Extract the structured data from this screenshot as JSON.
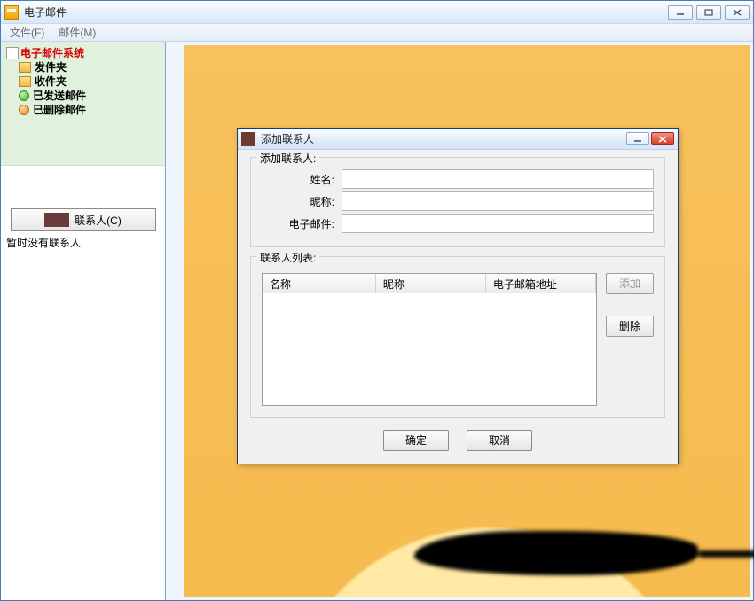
{
  "main": {
    "title": "电子邮件",
    "menu": {
      "file": "文件(F)",
      "mail": "邮件(M)"
    }
  },
  "sidebar": {
    "root": "电子邮件系统",
    "items": [
      {
        "label": "发件夹"
      },
      {
        "label": "收件夹"
      },
      {
        "label": "已发送邮件"
      },
      {
        "label": "已删除邮件"
      }
    ],
    "contacts_button": "联系人(C)",
    "empty_text": "暂时没有联系人"
  },
  "dialog": {
    "title": "添加联系人",
    "group_add": "添加联系人:",
    "label_name": "姓名:",
    "label_nick": "昵称:",
    "label_email": "电子邮件:",
    "value_name": "",
    "value_nick": "",
    "value_email": "",
    "group_list": "联系人列表:",
    "cols": {
      "name": "名称",
      "nick": "昵称",
      "email": "电子邮箱地址"
    },
    "btn_add": "添加",
    "btn_remove": "删除",
    "btn_ok": "确定",
    "btn_cancel": "取消"
  }
}
